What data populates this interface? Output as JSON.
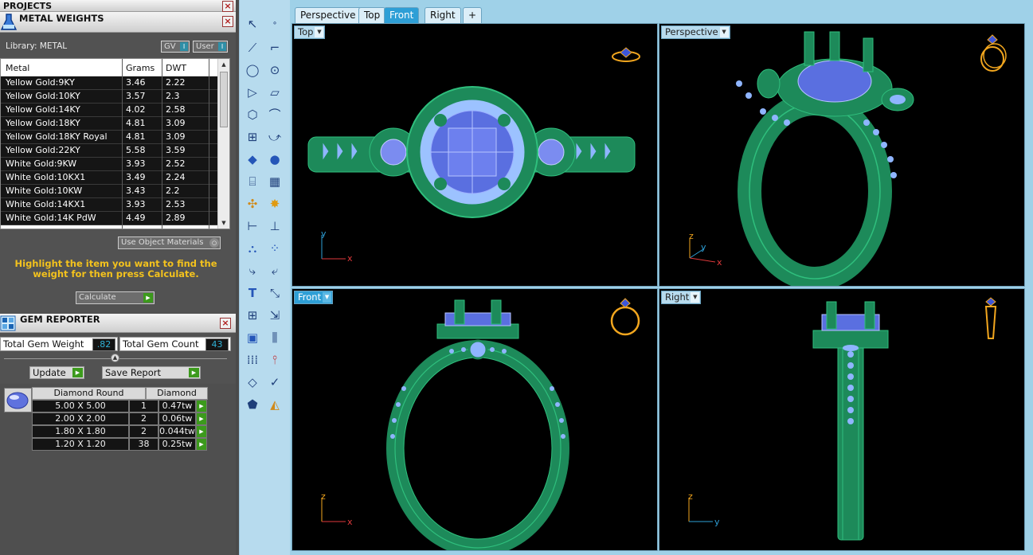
{
  "projects_title": "PROJECTS",
  "metal_weights": {
    "title": "METAL WEIGHTS",
    "library_label": "Library: METAL",
    "gv_label": "GV",
    "user_label": "User",
    "columns": [
      "Metal",
      "Grams",
      "DWT"
    ],
    "rows": [
      [
        "Yellow Gold:9KY",
        "3.46",
        "2.22"
      ],
      [
        "Yellow Gold:10KY",
        "3.57",
        "2.3"
      ],
      [
        "Yellow Gold:14KY",
        "4.02",
        "2.58"
      ],
      [
        "Yellow Gold:18KY",
        "4.81",
        "3.09"
      ],
      [
        "Yellow Gold:18KY Royal",
        "4.81",
        "3.09"
      ],
      [
        "Yellow Gold:22KY",
        "5.58",
        "3.59"
      ],
      [
        "White Gold:9KW",
        "3.93",
        "2.52"
      ],
      [
        "White Gold:10KX1",
        "3.49",
        "2.24"
      ],
      [
        "White Gold:10KW",
        "3.43",
        "2.2"
      ],
      [
        "White Gold:14KX1",
        "3.93",
        "2.53"
      ],
      [
        "White Gold:14K PdW",
        "4.49",
        "2.89"
      ]
    ],
    "use_object_materials": "Use Object Materials",
    "hint": "Highlight the item you want to find the weight for then press Calculate.",
    "calculate_label": "Calculate"
  },
  "gem_reporter": {
    "title": "GEM REPORTER",
    "total_gem_weight_label": "Total Gem Weight",
    "total_gem_weight": ".82",
    "total_gem_count_label": "Total Gem Count",
    "total_gem_count": "43",
    "update_label": "Update",
    "save_report_label": "Save Report",
    "table_headers": [
      "Diamond Round",
      "Diamond"
    ],
    "rows": [
      [
        "5.00 X 5.00",
        "1",
        "0.47tw"
      ],
      [
        "2.00 X 2.00",
        "2",
        "0.06tw"
      ],
      [
        "1.80 X 1.80",
        "2",
        "0.044tw"
      ],
      [
        "1.20 X 1.20",
        "38",
        "0.25tw"
      ]
    ]
  },
  "tabs": [
    "Perspective",
    "Top",
    "Front",
    "Right",
    "+"
  ],
  "active_tab": "Front",
  "viewports": {
    "top": "Top",
    "perspective": "Perspective",
    "front": "Front",
    "right": "Right"
  },
  "axes": {
    "top": [
      "y",
      "x"
    ],
    "perspective": [
      "z",
      "y",
      "x"
    ],
    "front": [
      "z",
      "x"
    ],
    "right": [
      "z",
      "y"
    ]
  },
  "colors": {
    "metal_green": "#1d8a5a",
    "gem_blue": "#5a6fe0",
    "accent_gold": "#f2a61e",
    "axis_x": "#e0393b",
    "axis_y": "#2e9fd6",
    "axis_z": "#f2a61e"
  }
}
